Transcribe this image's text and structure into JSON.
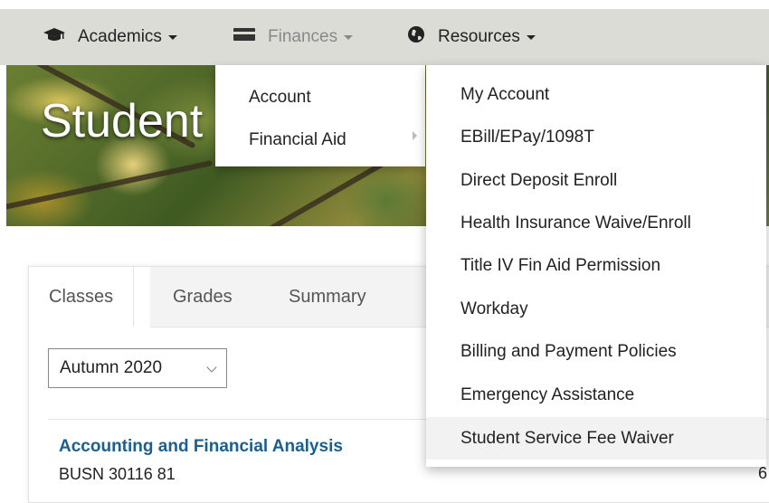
{
  "nav": {
    "items": [
      {
        "label": "Academics",
        "icon": "graduation-cap-icon"
      },
      {
        "label": "Finances",
        "icon": "credit-card-icon"
      },
      {
        "label": "Resources",
        "icon": "globe-icon"
      }
    ]
  },
  "hero": {
    "title": "Student Home"
  },
  "tabs": [
    "Classes",
    "Grades",
    "Summary"
  ],
  "term_select": {
    "value": "Autumn 2020"
  },
  "course": {
    "title": "Accounting and Financial Analysis",
    "code": "BUSN 30116 81"
  },
  "edge_text": "6",
  "finances_menu": {
    "items": [
      "Account",
      "Financial Aid"
    ]
  },
  "account_submenu": {
    "items": [
      "My Account",
      "EBill/EPay/1098T",
      "Direct Deposit Enroll",
      "Health Insurance Waive/Enroll",
      "Title IV Fin Aid Permission",
      "Workday",
      "Billing and Payment Policies",
      "Emergency Assistance",
      "Student Service Fee Waiver"
    ],
    "hovered": "Student Service Fee Waiver"
  }
}
